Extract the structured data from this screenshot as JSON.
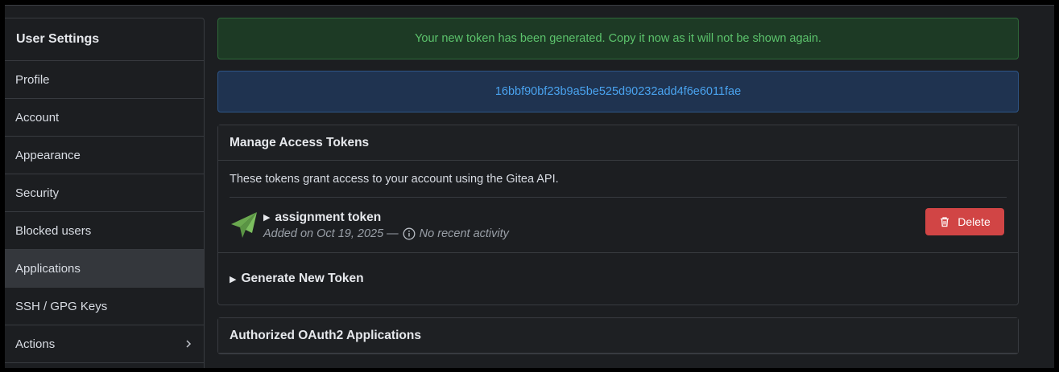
{
  "sidebar": {
    "title": "User Settings",
    "items": [
      {
        "label": "Profile"
      },
      {
        "label": "Account"
      },
      {
        "label": "Appearance"
      },
      {
        "label": "Security"
      },
      {
        "label": "Blocked users"
      },
      {
        "label": "Applications",
        "active": true
      },
      {
        "label": "SSH / GPG Keys"
      },
      {
        "label": "Actions",
        "icon": "chevron-right-icon"
      }
    ]
  },
  "alerts": {
    "success": "Your new token has been generated. Copy it now as it will not be shown again.",
    "token_value": "16bbf90bf23b9a5be525d90232add4f6e6011fae"
  },
  "tokens_box": {
    "title": "Manage Access Tokens",
    "description": "These tokens grant access to your account using the Gitea API.",
    "token": {
      "name": "assignment token",
      "added": "Added on Oct 19, 2025 —",
      "activity": "No recent activity",
      "icon": "send-icon",
      "delete_label": "Delete"
    },
    "generate_label": "Generate New Token"
  },
  "oauth_box": {
    "title": "Authorized OAuth2 Applications"
  },
  "colors": {
    "success_text": "#5cc36c",
    "info_text": "#4aa3ef",
    "danger": "#d14545",
    "token_icon": "#6aa84f"
  }
}
